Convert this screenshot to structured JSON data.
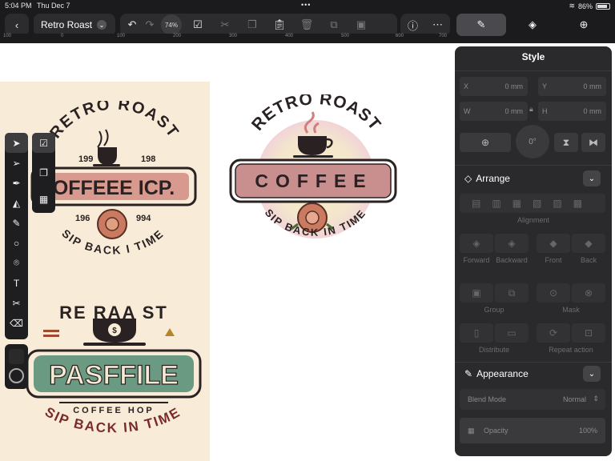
{
  "status": {
    "time": "5:04 PM",
    "date": "Thu Dec 7",
    "battery": "86%",
    "battery_level": 0.86
  },
  "toolbar": {
    "document_title": "Retro Roast",
    "zoom": "74%",
    "icons": [
      "back-icon",
      "undo-icon",
      "redo-icon",
      "select-icon",
      "cut-icon",
      "copy-icon",
      "paste-icon",
      "trash-icon",
      "duplicate-icon",
      "group-icon",
      "help-icon",
      "more-icon"
    ]
  },
  "ruler_ticks": [
    "100",
    "0",
    "100",
    "200",
    "300",
    "400",
    "500",
    "600",
    "700"
  ],
  "panel_tabs": [
    {
      "name": "style",
      "icon": "brush-icon",
      "active": true
    },
    {
      "name": "layers",
      "icon": "layers-icon",
      "active": false
    },
    {
      "name": "add",
      "icon": "plus-icon",
      "active": false
    }
  ],
  "style_panel": {
    "title": "Style",
    "fields": [
      {
        "label": "X",
        "value": "0 mm"
      },
      {
        "label": "Y",
        "value": "0 mm"
      },
      {
        "label": "W",
        "value": "0 mm"
      },
      {
        "label": "H",
        "value": "0 mm"
      }
    ],
    "rotation": "0°",
    "arrange": {
      "title": "Arrange",
      "alignment_label": "Alignment",
      "order_labels": [
        "Forward",
        "Backward",
        "Front",
        "Back"
      ],
      "group_label": "Group",
      "mask_label": "Mask",
      "distribute_label": "Distribute",
      "repeat_label": "Repeat action"
    },
    "appearance": {
      "title": "Appearance",
      "blend_label": "Blend Mode",
      "blend_value": "Normal",
      "opacity_label": "Opacity",
      "opacity_value": "100%"
    }
  },
  "logo_main": {
    "top_text": "RETRO ROAST",
    "banner_text": "COFFEE",
    "bottom_text": "SIP BACK IN TIME"
  },
  "artboard_logo1": {
    "top_text": "RETRO ROAST",
    "year_left": "199",
    "year_right": "198",
    "banner_text": "OFFEEE ICP.",
    "year_left2": "196",
    "year_right2": "994",
    "bottom_text": "SIP BACK I TIME"
  },
  "artboard_logo2": {
    "top_text": "RE RAA ST",
    "banner_text": "PASFFILE",
    "sub_text": "COFFEE HOP",
    "bottom_text": "SIP BACK IN TIME"
  },
  "colors": {
    "banner_pink": "#c98f8f",
    "banner_green": "#6b9a82",
    "dark": "#2a2222",
    "cream": "#f8ecd8"
  }
}
